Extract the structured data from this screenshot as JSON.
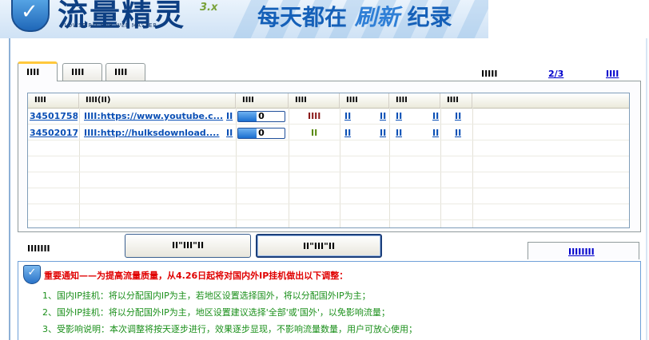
{
  "header": {
    "logo_title": "流量精灵",
    "logo_badge": "3.x",
    "logo_subtitle": "FLOWSPIRIT FOR WEB MASTER",
    "slogan_part1": "每天都在",
    "slogan_part2": "刷新",
    "slogan_part3": "纪录"
  },
  "tabs": [
    {
      "label": "IIII",
      "active": true
    },
    {
      "label": "IIII",
      "active": false
    },
    {
      "label": "IIII",
      "active": false
    }
  ],
  "tabbar": {
    "plain_label": "IIIII",
    "page_indicator": "2/3",
    "link_label": "IIII"
  },
  "table": {
    "columns": [
      "IIII",
      "IIII(II)",
      "IIII",
      "IIII",
      "IIII",
      "IIII",
      "IIII",
      "II"
    ],
    "rows": [
      {
        "id": "34501758",
        "task": "IIII:https://www.youtube.c...",
        "col3": "II",
        "progress": 0,
        "status": "IIII",
        "status_color": "#8b1a1a",
        "c5a": "II",
        "c5b": "II",
        "c6a": "II",
        "c6b": "II",
        "c7": "II"
      },
      {
        "id": "34502017",
        "task": "IIII:http://hulksdownload....",
        "col3": "II",
        "progress": 0,
        "status": "II",
        "status_color": "#5a8a10",
        "c5a": "II",
        "c5b": "II",
        "c6a": "II",
        "c6b": "II",
        "c7": "II"
      }
    ]
  },
  "controls": {
    "left_label": "IIIIIII",
    "button_a": "II\"III\"II",
    "button_b": "II\"III\"II",
    "right_link": "IIIIIIII"
  },
  "notice": {
    "title": "重要通知——为提高流量质量，从4.26日起将对国内外IP挂机做出以下调整：",
    "lines": [
      "1、国内IP挂机：将以分配国内IP为主，若地区设置选择国外，将以分配国外IP为主；",
      "2、国外IP挂机：将以分配国外IP为主，地区设置建议选择'全部'或'国外'，以免影响流量；",
      "3、受影响说明：本次调整将按天逐步进行，效果逐步显现，不影响流量数量，用户可放心使用；"
    ]
  },
  "colors": {
    "accent": "#0a4fb5",
    "notice_title": "#e00000",
    "notice_text": "#1a8f1a",
    "tab_highlight": "#ffc83c"
  }
}
